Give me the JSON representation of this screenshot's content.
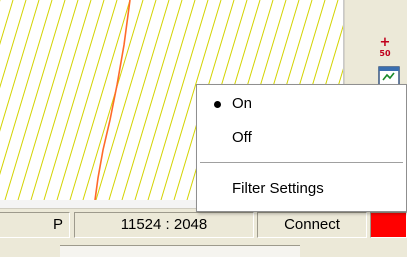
{
  "menu": {
    "items": [
      {
        "label": "On",
        "checked": true
      },
      {
        "label": "Off",
        "checked": false
      },
      {
        "label": "Filter Settings",
        "checked": false
      }
    ]
  },
  "statusbar": {
    "left_text": "P",
    "coords": "11524 : 2048",
    "connect_label": "Connect",
    "indicator_color": "#ff0000"
  },
  "toolbar": {
    "zoom_plus": "+",
    "zoom_num": "50"
  },
  "plot": {
    "hatch_color": "#d4d400",
    "trace_color": "#ff6a2a"
  }
}
